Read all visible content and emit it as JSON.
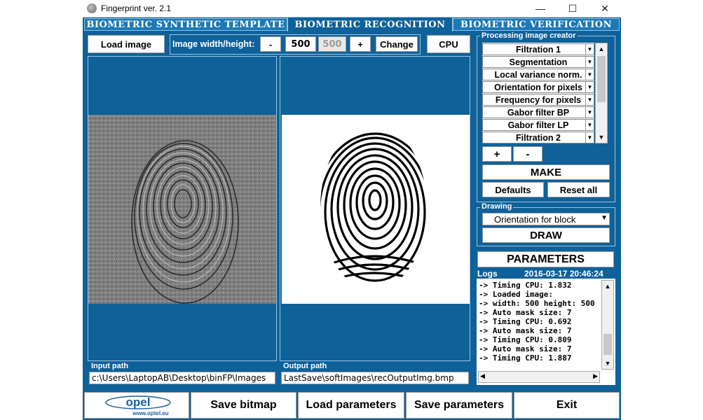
{
  "window": {
    "title": "Fingerprint ver. 2.1",
    "minimize": "—",
    "maximize": "☐",
    "close": "✕"
  },
  "tabs": [
    "BIOMETRIC SYNTHETIC TEMPLATE",
    "BIOMETRIC RECOGNITION",
    "BIOMETRIC VERIFICATION"
  ],
  "toolbar": {
    "load_image": "Load image",
    "size_label": "Image width/height:",
    "minus": "-",
    "width_value": "500",
    "height_value": "500",
    "plus": "+",
    "change": "Change",
    "cpu": "CPU"
  },
  "processing": {
    "title": "Processing image creator",
    "items": [
      "Filtration 1",
      "Segmentation",
      "Local variance norm.",
      "Orientation for pixels",
      "Frequency for pixels",
      "Gabor filter BP",
      "Gabor filter LP",
      "Filtration 2"
    ],
    "plus": "+",
    "minus": "-",
    "make": "MAKE",
    "defaults": "Defaults",
    "reset_all": "Reset all"
  },
  "drawing": {
    "title": "Drawing",
    "selected": "Orientation for block",
    "draw": "DRAW"
  },
  "parameters": "PARAMETERS",
  "logs": {
    "title": "Logs",
    "timestamp": "2016-03-17 20:46:24",
    "lines": [
      "-> Timing CPU: 1.832",
      "-> Loaded image:",
      "-> width: 500 height: 500",
      "-> Auto mask size: 7",
      "-> Timing CPU: 0.692",
      "-> Auto mask size: 7",
      "-> Timing CPU: 0.809",
      "-> Auto mask size: 7",
      "-> Timing CPU: 1.887"
    ]
  },
  "paths": {
    "input_label": "Input path",
    "input_value": "c:\\Users\\LaptopAB\\Desktop\\binFP\\Images",
    "output_label": "Output path",
    "output_value": "LastSave\\softImages\\recOutputImg.bmp"
  },
  "bottom": {
    "logo_text": "opel",
    "logo_url": "www.optel.eu",
    "save_bitmap": "Save bitmap",
    "load_parameters": "Load parameters",
    "save_parameters": "Save parameters",
    "exit": "Exit"
  },
  "colors": {
    "background": "#0f6199",
    "tab": "#1d79b5",
    "border": "#9cc5e2"
  }
}
